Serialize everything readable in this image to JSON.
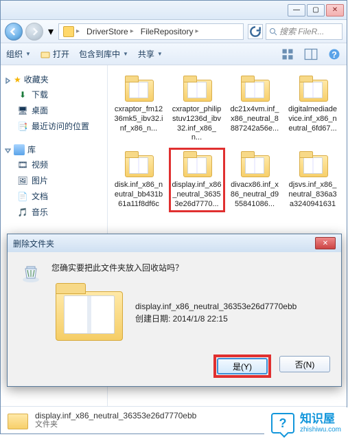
{
  "window": {
    "min": "—",
    "max": "▢",
    "close": "✕"
  },
  "breadcrumb": {
    "seg1": "DriverStore",
    "seg2": "FileRepository"
  },
  "search": {
    "placeholder": "搜索 FileR..."
  },
  "toolbar": {
    "organize": "组织",
    "open": "打开",
    "include": "包含到库中",
    "share": "共享"
  },
  "tree": {
    "favorites": "收藏夹",
    "downloads": "下载",
    "desktop": "桌面",
    "recent": "最近访问的位置",
    "libraries": "库",
    "videos": "视频",
    "pictures": "图片",
    "documents": "文档",
    "music": "音乐"
  },
  "files": [
    "cxraptor_fm1236mk5_ibv32.inf_x86_n...",
    "cxraptor_philipstuv1236d_ibv32.inf_x86_n...",
    "dc21x4vm.inf_x86_neutral_8887242a56e...",
    "digitalmediadevice.inf_x86_neutral_6fd67...",
    "disk.inf_x86_neutral_bb431b61a11f8df6c",
    "display.inf_x86_neutral_36353e26d7770...",
    "divacx86.inf_x86_neutral_d955841086...",
    "djsvs.inf_x86_neutral_836a3a3240941631"
  ],
  "statusbar": {
    "name": "display.inf_x86_neutral_36353e26d7770ebb",
    "type": "文件夹"
  },
  "dialog": {
    "title": "删除文件夹",
    "question": "您确实要把此文件夹放入回收站吗？",
    "filename": "display.inf_x86_neutral_36353e26d7770ebb",
    "created_label": "创建日期: ",
    "created_value": "2014/1/8 22:15",
    "yes": "是(Y)",
    "no": "否(N)"
  },
  "watermark": {
    "cn": "知识屋",
    "en": "zhishiwu.com"
  }
}
